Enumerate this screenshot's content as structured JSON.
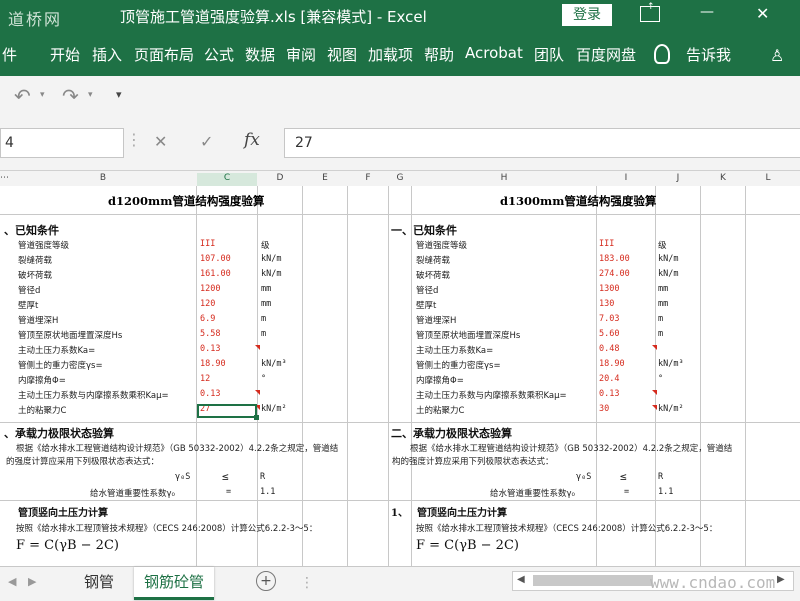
{
  "window": {
    "title": "顶管施工管道强度验算.xls  [兼容模式]  -  Excel",
    "watermark_top": "道桥网",
    "login": "登录",
    "restore_icon": "restore-icon",
    "minimize_glyph": "—",
    "close_glyph": "✕"
  },
  "ribbon": {
    "tabs": [
      "件",
      "开始",
      "插入",
      "页面布局",
      "公式",
      "数据",
      "审阅",
      "视图",
      "加载项",
      "帮助",
      "Acrobat",
      "团队",
      "百度网盘",
      "告诉我"
    ],
    "bulb_icon": "lightbulb-icon",
    "share_icon": "share-user-icon"
  },
  "qat": {
    "undo": "↶",
    "redo": "↷",
    "more": "▾"
  },
  "formula_bar": {
    "name_box": "4",
    "cancel": "✕",
    "enter": "✓",
    "fx": "fx",
    "value": "27"
  },
  "columns": [
    "B",
    "C",
    "D",
    "E",
    "F",
    "G",
    "H",
    "I",
    "J",
    "K",
    "L"
  ],
  "left": {
    "title": "d1200mm管道结构强度验算",
    "sec1": "、已知条件",
    "rows": [
      {
        "label": "管道强度等级",
        "value": "III",
        "unit": "级"
      },
      {
        "label": "裂缝荷载",
        "value": "107.00",
        "unit": "kN/m"
      },
      {
        "label": "破坏荷载",
        "value": "161.00",
        "unit": "kN/m"
      },
      {
        "label": "管径d",
        "value": "1200",
        "unit": "mm"
      },
      {
        "label": "壁厚t",
        "value": "120",
        "unit": "mm"
      },
      {
        "label": "管道埋深H",
        "value": "6.9",
        "unit": "m"
      },
      {
        "label": "管顶至原状地面埋置深度Hs",
        "value": "5.58",
        "unit": "m"
      },
      {
        "label": "主动土压力系数Ka=",
        "value": "0.13",
        "unit": ""
      },
      {
        "label": "管侧土的重力密度γs=",
        "value": "18.90",
        "unit": "kN/m³"
      },
      {
        "label": "内摩擦角Φ=",
        "value": "12",
        "unit": "°"
      },
      {
        "label": "主动土压力系数与内摩擦系数乘积Kaμ=",
        "value": "0.13",
        "unit": ""
      },
      {
        "label": "土的粘聚力C",
        "value": "27",
        "unit": "kN/m²"
      }
    ],
    "sec2": "、承载力极限状态验算",
    "para": "根据《给水排水工程管道结构设计规范》（GB 50332-2002）4.2.2条之规定，管道结",
    "para2": "的强度计算应采用下列极限状态表达式：",
    "ineq_left": "γ₀S",
    "ineq_op": "≤",
    "ineq_right": "R",
    "gamma_label": "给水管道重要性系数γ₀",
    "gamma_eq": "=",
    "gamma_val": "1.1",
    "sec3": "管顶竖向土压力计算",
    "para3": "按照《给水排水工程顶管技术规程》（CECS 246:2008）计算公式6.2.2-3～5：",
    "formula": "F = C(γB − 2C)"
  },
  "right": {
    "title": "d1300mm管道结构强度验算",
    "sec1": "一、已知条件",
    "rows": [
      {
        "label": "管道强度等级",
        "value": "III",
        "unit": "级"
      },
      {
        "label": "裂缝荷载",
        "value": "183.00",
        "unit": "kN/m"
      },
      {
        "label": "破坏荷载",
        "value": "274.00",
        "unit": "kN/m"
      },
      {
        "label": "管径d",
        "value": "1300",
        "unit": "mm"
      },
      {
        "label": "壁厚t",
        "value": "130",
        "unit": "mm"
      },
      {
        "label": "管道埋深H",
        "value": "7.03",
        "unit": "m"
      },
      {
        "label": "管顶至原状地面埋置深度Hs",
        "value": "5.60",
        "unit": "m"
      },
      {
        "label": "主动土压力系数Ka=",
        "value": "0.48",
        "unit": ""
      },
      {
        "label": "管侧土的重力密度γs=",
        "value": "18.90",
        "unit": "kN/m³"
      },
      {
        "label": "内摩擦角Φ=",
        "value": "20.4",
        "unit": "°"
      },
      {
        "label": "主动土压力系数与内摩擦系数乘积Kaμ=",
        "value": "0.13",
        "unit": ""
      },
      {
        "label": "土的粘聚力C",
        "value": "30",
        "unit": "kN/m²"
      }
    ],
    "sec2": "二、承载力极限状态验算",
    "para": "根据《给水排水工程管道结构设计规范》（GB 50332-2002）4.2.2条之规定，管道结",
    "para2": "构的强度计算应采用下列极限状态表达式：",
    "ineq_left": "γ₀S",
    "ineq_op": "≤",
    "ineq_right": "R",
    "gamma_label": "给水管道重要性系数γ₀",
    "gamma_eq": "=",
    "gamma_val": "1.1",
    "sec3_num": "1、",
    "sec3": "管顶竖向土压力计算",
    "para3": "按照《给水排水工程顶管技术规程》（CECS 246:2008）计算公式6.2.2-3～5：",
    "formula": "F = C(γB − 2C)"
  },
  "sheet_tabs": {
    "tabs": [
      "钢管",
      "钢筋砼管"
    ],
    "active": 1,
    "add": "+",
    "watermark": "www.cndao.com"
  },
  "colors": {
    "excel_green": "#1e7145",
    "red": "#d52b1e"
  }
}
